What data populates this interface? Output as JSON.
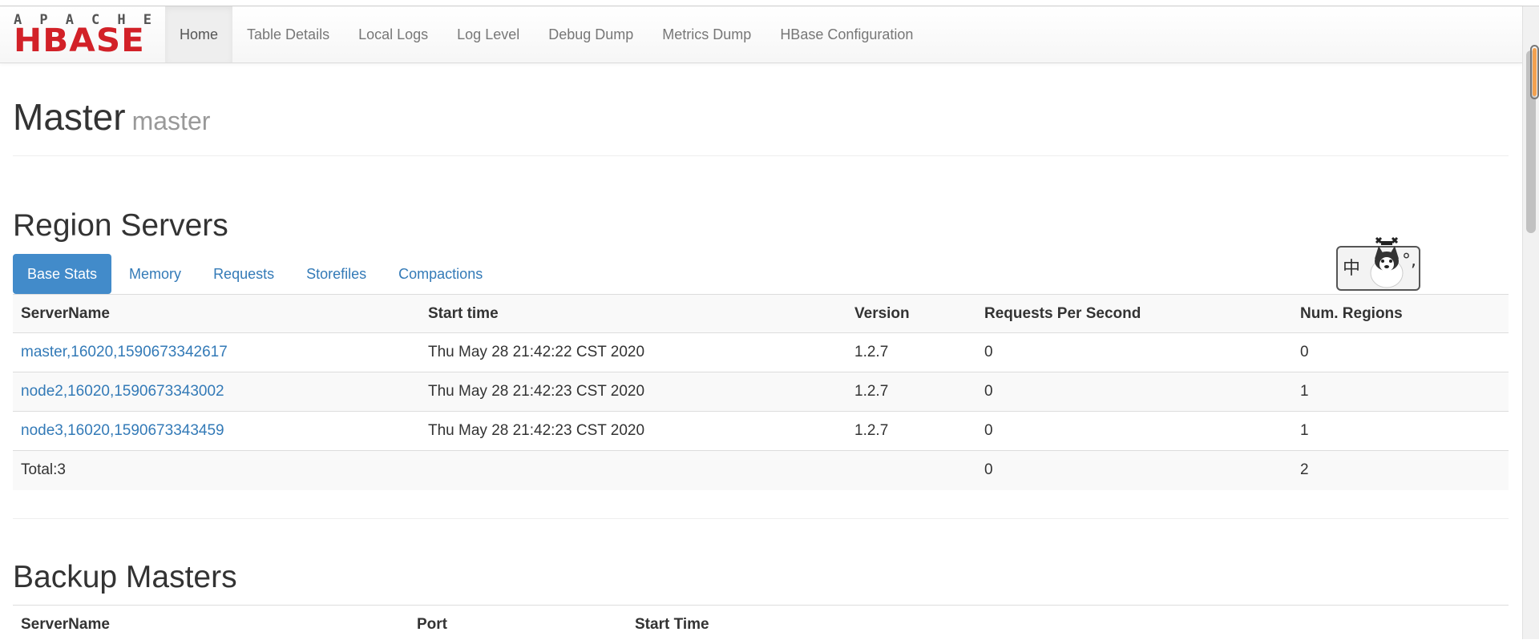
{
  "brand": {
    "top_text": "APACHE",
    "top_letters": [
      "A",
      "P",
      "A",
      "C",
      "H",
      "E"
    ],
    "logo_text": "HBASE"
  },
  "nav": {
    "items": [
      {
        "label": "Home",
        "active": true
      },
      {
        "label": "Table Details"
      },
      {
        "label": "Local Logs"
      },
      {
        "label": "Log Level"
      },
      {
        "label": "Debug Dump"
      },
      {
        "label": "Metrics Dump"
      },
      {
        "label": "HBase Configuration"
      }
    ]
  },
  "header": {
    "title": "Master",
    "subtitle": "master"
  },
  "region_servers": {
    "title": "Region Servers",
    "tabs": [
      {
        "label": "Base Stats",
        "active": true
      },
      {
        "label": "Memory"
      },
      {
        "label": "Requests"
      },
      {
        "label": "Storefiles"
      },
      {
        "label": "Compactions"
      }
    ],
    "columns": [
      "ServerName",
      "Start time",
      "Version",
      "Requests Per Second",
      "Num. Regions"
    ],
    "rows": [
      {
        "server": "master,16020,1590673342617",
        "start": "Thu May 28 21:42:22 CST 2020",
        "version": "1.2.7",
        "rps": "0",
        "regions": "0"
      },
      {
        "server": "node2,16020,1590673343002",
        "start": "Thu May 28 21:42:23 CST 2020",
        "version": "1.2.7",
        "rps": "0",
        "regions": "1"
      },
      {
        "server": "node3,16020,1590673343459",
        "start": "Thu May 28 21:42:23 CST 2020",
        "version": "1.2.7",
        "rps": "0",
        "regions": "1"
      }
    ],
    "total": {
      "label": "Total:3",
      "rps": "0",
      "regions": "2"
    }
  },
  "backup_masters": {
    "title": "Backup Masters",
    "columns": [
      "ServerName",
      "Port",
      "Start Time"
    ]
  },
  "ime": {
    "char": "中",
    "punct": "°,"
  },
  "colors": {
    "link": "#337ab7",
    "active_tab": "#428bca",
    "logo_red": "#d22128"
  }
}
